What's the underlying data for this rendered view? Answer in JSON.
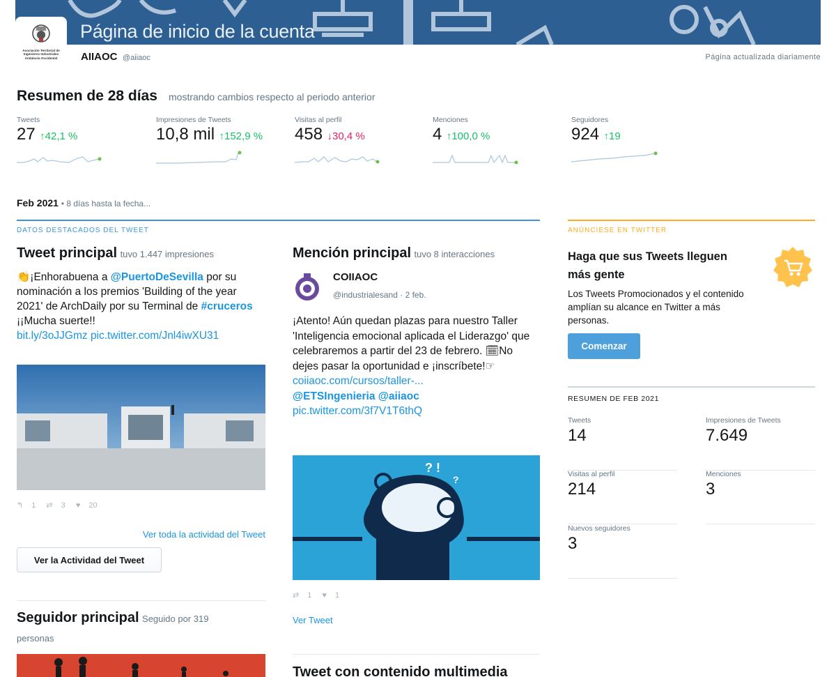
{
  "header": {
    "title": "Página de inicio de la cuenta",
    "logo_text": "Asociación Territorial de Ingenieros Industriales Andalucía Occidental",
    "account_name": "AIIAOC",
    "account_handle": "@aiiaoc",
    "updated": "Página actualizada diariamente"
  },
  "summary": {
    "title": "Resumen de 28 días",
    "subtitle": "mostrando cambios respecto al periodo anterior",
    "metrics": [
      {
        "label": "Tweets",
        "value": "27",
        "change": "↑42,1 %",
        "direction": "up"
      },
      {
        "label": "Impresiones de Tweets",
        "value": "10,8 mil",
        "change": "↑152,9 %",
        "direction": "up"
      },
      {
        "label": "Visitas al perfil",
        "value": "458",
        "change": "↓30,4 %",
        "direction": "down"
      },
      {
        "label": "Menciones",
        "value": "4",
        "change": "↑100,0 %",
        "direction": "up"
      },
      {
        "label": "Seguidores",
        "value": "924",
        "change": "↑19",
        "direction": "up"
      }
    ]
  },
  "period": {
    "month": "Feb 2021",
    "sub": "• 8 días hasta la fecha..."
  },
  "highlights": {
    "label": "DATOS DESTACADOS DEL TWEET",
    "top_tweet": {
      "title": "Tweet principal",
      "sub": "tuvo 1.447 impresiones",
      "text_1": "👏¡Enhorabuena a ",
      "mention": "@PuertoDeSevilla",
      "text_2": " por su nominación a los premios 'Building of the year 2021' de ArchDaily por su Terminal de ",
      "hashtag": "#cruceros",
      "text_3": " ¡¡Mucha suerte!!",
      "links": "bit.ly/3oJJGmz pic.twitter.com/Jnl4iwXU31",
      "replies": "1",
      "retweets": "3",
      "likes": "20",
      "activity_link": "Ver toda la actividad del Tweet",
      "activity_button": "Ver la Actividad del Tweet"
    },
    "top_mention": {
      "title": "Mención principal",
      "sub": "tuvo 8 interacciones",
      "user": "COIIAOC",
      "handle": "@industrialesand · 2 feb.",
      "text_1": "¡Atento! Aún quedan plazas para nuestro Taller 'Inteligencia emocional aplicada el Liderazgo' que celebraremos a partir del 23 de febrero. 🗓No dejes pasar la oportunidad e ¡inscríbete!☞",
      "link": "coiiaoc.com/cursos/taller-...",
      "mentions": "@ETSIngenieria @aiiaoc",
      "pic": "pic.twitter.com/3f7V1T6thQ",
      "retweets": "1",
      "likes": "1",
      "view_tweet": "Ver Tweet"
    },
    "top_follower": {
      "title": "Seguidor principal",
      "sub": "Seguido por 319",
      "sub2": "personas"
    },
    "media_tweet": {
      "title": "Tweet con contenido multimedia"
    }
  },
  "ad": {
    "label": "ANÚNCIESE EN TWITTER",
    "title": "Haga que sus Tweets lleguen más gente",
    "body": "Los Tweets Promocionados y el contenido amplían su alcance en Twitter a más personas.",
    "button": "Comenzar",
    "icon": "cart-icon",
    "accent": "#ffad1f"
  },
  "feb_summary": {
    "label": "RESUMEN DE FEB 2021",
    "stats": [
      {
        "label": "Tweets",
        "value": "14"
      },
      {
        "label": "Impresiones de Tweets",
        "value": "7.649"
      },
      {
        "label": "Visitas al perfil",
        "value": "214"
      },
      {
        "label": "Menciones",
        "value": "3"
      },
      {
        "label": "Nuevos seguidores",
        "value": "3"
      }
    ]
  }
}
